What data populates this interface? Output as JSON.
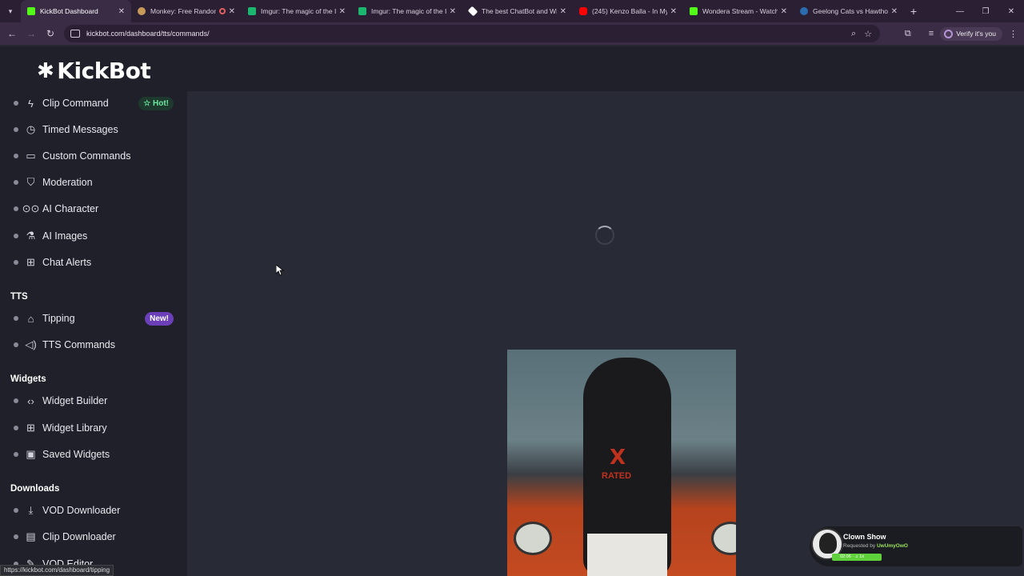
{
  "browser": {
    "tabs": [
      {
        "title": "KickBot Dashboard",
        "active": true,
        "favicon_color": "#53fc18"
      },
      {
        "title": "Monkey: Free Random",
        "favicon_color": "#c79a5a"
      },
      {
        "title": "Imgur: The magic of the I",
        "favicon_color": "#1bb76e"
      },
      {
        "title": "Imgur: The magic of the I",
        "favicon_color": "#1bb76e"
      },
      {
        "title": "The best ChatBot and Wi",
        "favicon_color": "#ffffff"
      },
      {
        "title": "(245) Kenzo Balla - In My",
        "favicon_color": "#ff0000"
      },
      {
        "title": "Wondera Stream - Watch",
        "favicon_color": "#53fc18"
      },
      {
        "title": "Geelong Cats vs Hawthor",
        "favicon_color": "#2b6cb0"
      }
    ],
    "url": "kickbot.com/dashboard/tts/commands/",
    "verify_label": "Verify it's you",
    "status_url": "https://kickbot.com/dashboard/tipping"
  },
  "app": {
    "logo_text": "KickBot",
    "nav": {
      "clip_command": "Clip Command",
      "hot_badge": "Hot!",
      "timed_messages": "Timed Messages",
      "custom_commands": "Custom Commands",
      "moderation": "Moderation",
      "ai_character": "AI Character",
      "ai_images": "AI Images",
      "chat_alerts": "Chat Alerts",
      "tts_section": "TTS",
      "tipping": "Tipping",
      "new_badge": "New!",
      "tts_commands": "TTS Commands",
      "widgets_section": "Widgets",
      "widget_builder": "Widget Builder",
      "widget_library": "Widget Library",
      "saved_widgets": "Saved Widgets",
      "downloads_section": "Downloads",
      "vod_downloader": "VOD Downloader",
      "clip_downloader": "Clip Downloader",
      "vod_editor": "VOD Editor"
    },
    "photo_text": {
      "x": "X",
      "rated": "RATED"
    },
    "song_widget": {
      "title": "Clown Show",
      "requested_by_label": "Requested by",
      "requester": "UwUmyOwO",
      "progress_label": "02:06 · ♫ 1x"
    }
  }
}
